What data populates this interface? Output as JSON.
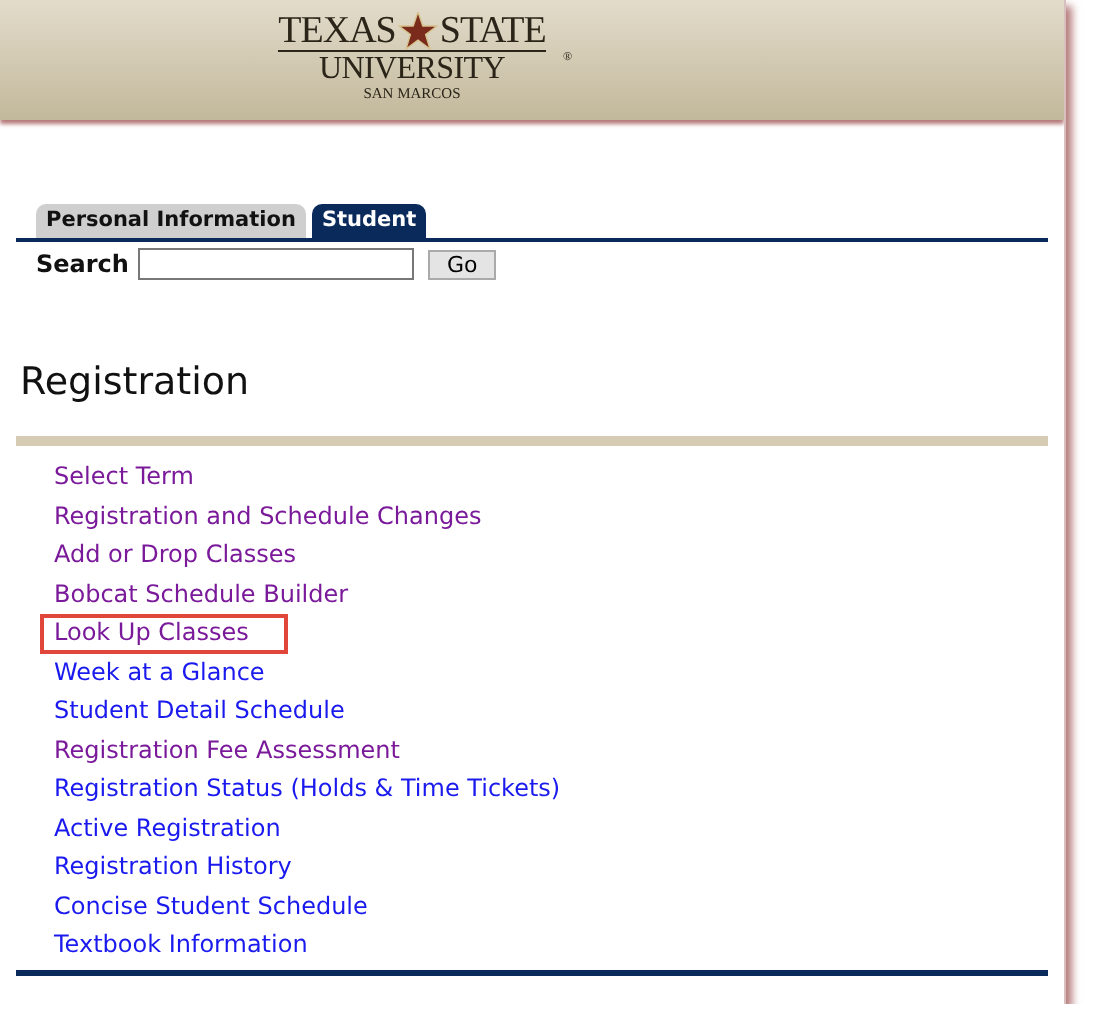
{
  "header": {
    "logo": {
      "left_word": "TEXAS",
      "right_word": "STATE",
      "mark": "®",
      "line2": "UNIVERSITY",
      "line3": "SAN MARCOS"
    }
  },
  "tabs": [
    {
      "label": "Personal Information",
      "selected": false
    },
    {
      "label": "Student",
      "selected": true
    }
  ],
  "search": {
    "label": "Search",
    "button": "Go"
  },
  "heading": "Registration",
  "links": [
    {
      "label": "Select Term",
      "visited": true,
      "highlighted": false
    },
    {
      "label": "Registration and Schedule Changes",
      "visited": true,
      "highlighted": false
    },
    {
      "label": "Add or Drop Classes",
      "visited": true,
      "highlighted": false
    },
    {
      "label": "Bobcat Schedule Builder",
      "visited": true,
      "highlighted": false
    },
    {
      "label": "Look Up Classes",
      "visited": true,
      "highlighted": true
    },
    {
      "label": "Week at a Glance",
      "visited": false,
      "highlighted": false
    },
    {
      "label": "Student Detail Schedule",
      "visited": false,
      "highlighted": false
    },
    {
      "label": "Registration Fee Assessment",
      "visited": true,
      "highlighted": false
    },
    {
      "label": "Registration Status (Holds & Time Tickets)",
      "visited": false,
      "highlighted": false
    },
    {
      "label": "Active Registration",
      "visited": false,
      "highlighted": false
    },
    {
      "label": "Registration History",
      "visited": false,
      "highlighted": false
    },
    {
      "label": "Concise Student Schedule",
      "visited": false,
      "highlighted": false
    },
    {
      "label": "Textbook Information",
      "visited": false,
      "highlighted": false
    }
  ]
}
